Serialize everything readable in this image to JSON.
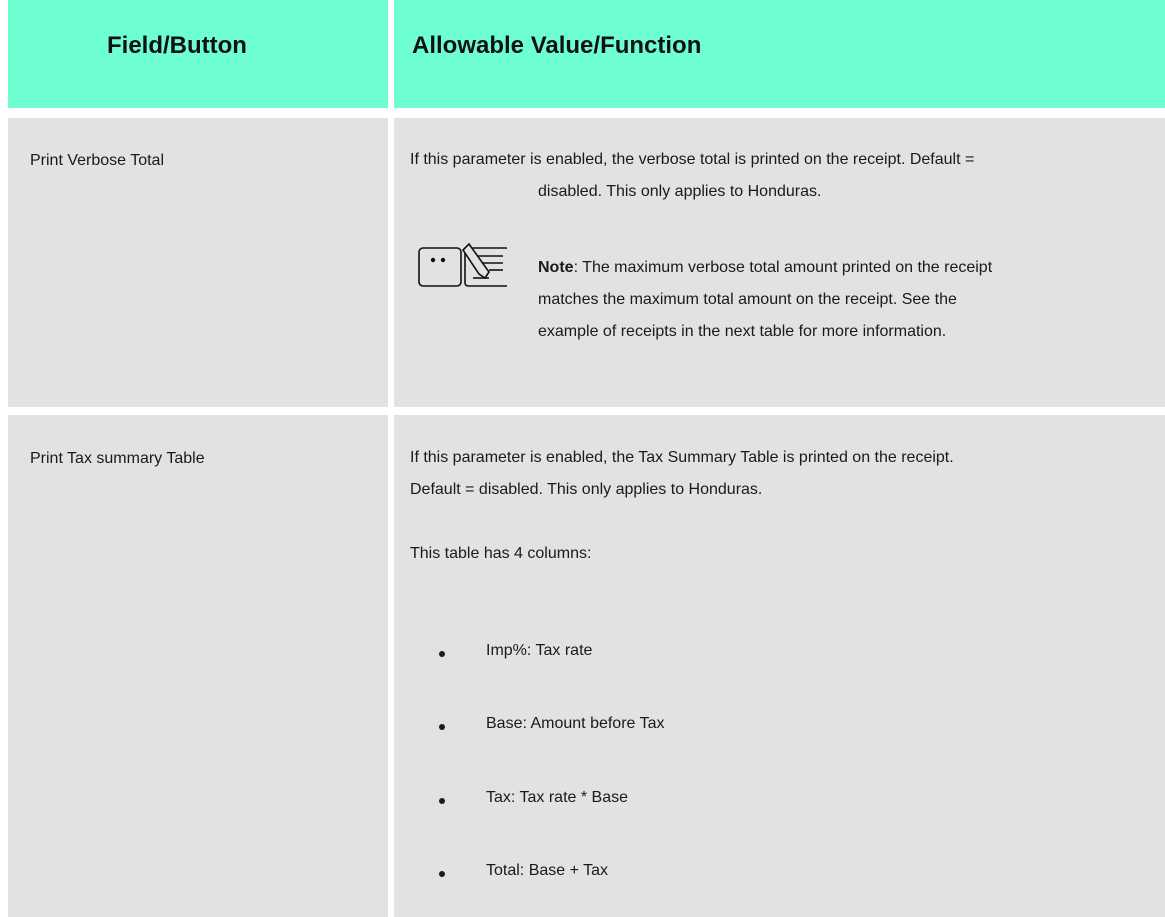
{
  "table": {
    "headers": {
      "field": "Field/Button",
      "value": "Allowable Value/Function"
    },
    "rows": [
      {
        "field": "Print Verbose Total",
        "description_line1": "If this parameter is enabled, the verbose total is printed on the receipt. Default =",
        "description_line2": "disabled. This only applies to Honduras.",
        "note": {
          "icon": "note-icon",
          "label": "Note",
          "line1": ": The maximum verbose total amount printed on the receipt",
          "line2": "matches the maximum total amount on the receipt. See the",
          "line3": "example of receipts in the next table for more information."
        }
      },
      {
        "field": "Print Tax summary Table",
        "description_line1": "If this parameter is enabled, the Tax Summary Table is printed on the receipt.",
        "description_line2": "Default = disabled. This only applies to Honduras.",
        "columns_intro": "This table has 4 columns:",
        "bullets": [
          "Imp%: Tax rate",
          "Base: Amount before Tax",
          "Tax: Tax rate * Base",
          "Total: Base + Tax"
        ]
      }
    ]
  },
  "colors": {
    "header_bg": "#6dffd2",
    "body_bg": "#e2e2e2",
    "grid_line": "#ffffff"
  }
}
